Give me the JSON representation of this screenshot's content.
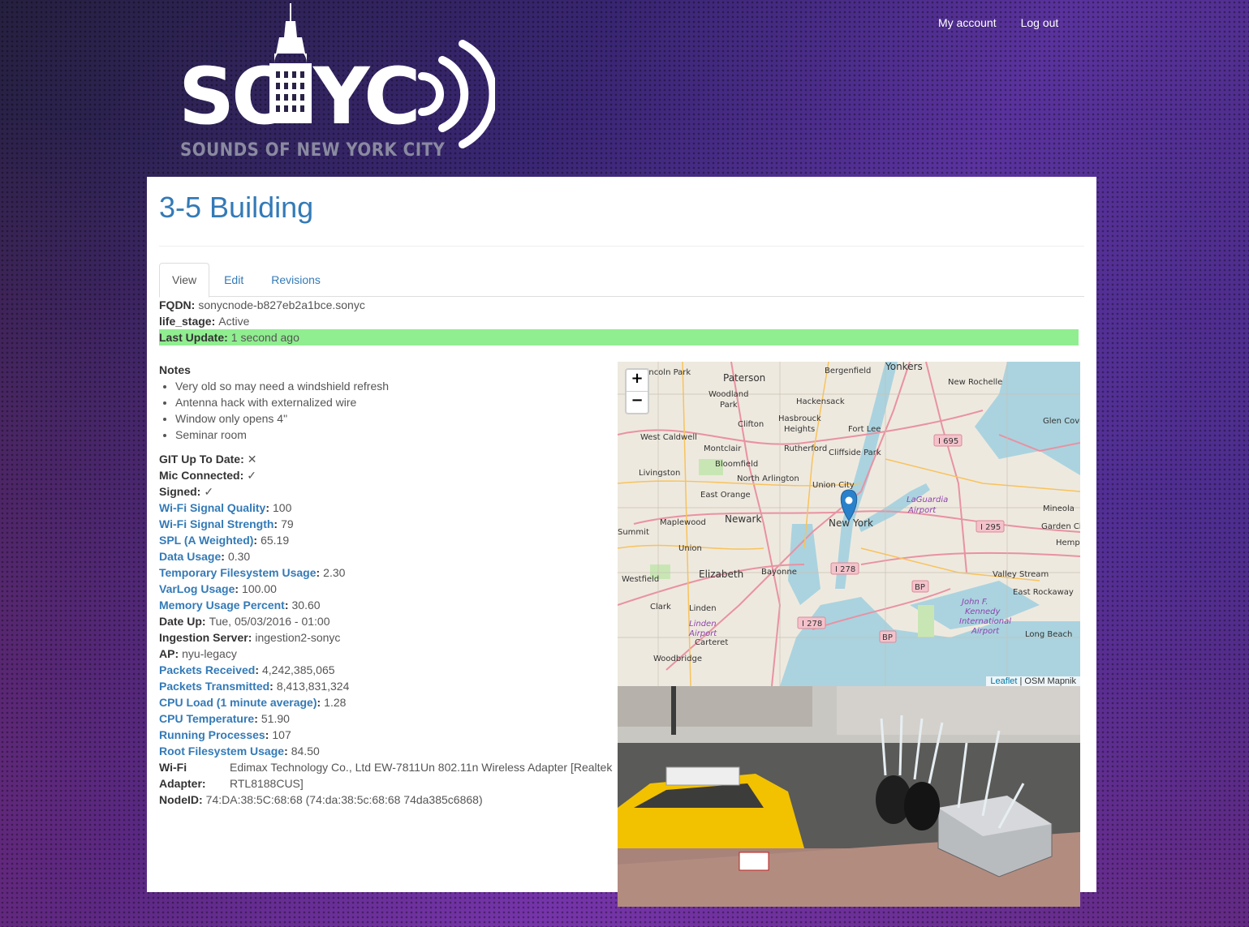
{
  "header": {
    "logo_text": "SONYC",
    "logo_subtitle": "SOUNDS OF NEW YORK CITY",
    "nav": {
      "my_account": "My account",
      "log_out": "Log out"
    }
  },
  "page": {
    "title": "3-5 Building",
    "tabs": [
      {
        "label": "View",
        "active": true
      },
      {
        "label": "Edit",
        "active": false
      },
      {
        "label": "Revisions",
        "active": false
      }
    ]
  },
  "summary": {
    "fqdn": {
      "label": "FQDN:",
      "value": "sonycnode-b827eb2a1bce.sonyc"
    },
    "life_stage": {
      "label": "life_stage:",
      "value": "Active"
    },
    "last_update": {
      "label": "Last Update:",
      "value": "1 second ago",
      "color": "#90ee90"
    }
  },
  "notes": {
    "label": "Notes",
    "items": [
      "Very old so may need a windshield refresh",
      "Antenna hack with externalized wire",
      "Window only opens 4\"",
      "Seminar room"
    ]
  },
  "fields": {
    "git": {
      "label": "GIT Up To Date:",
      "value": "✕"
    },
    "mic": {
      "label": "Mic Connected:",
      "value": "✓"
    },
    "signed": {
      "label": "Signed:",
      "value": "✓"
    },
    "wifi_quality": {
      "label": "Wi-Fi Signal Quality",
      "value": "100"
    },
    "wifi_strength": {
      "label": "Wi-Fi Signal Strength",
      "value": "79"
    },
    "spl": {
      "label": "SPL (A Weighted)",
      "value": "65.19"
    },
    "data_usage": {
      "label": "Data Usage",
      "value": "0.30"
    },
    "tmpfs": {
      "label": "Temporary Filesystem Usage",
      "value": "2.30"
    },
    "varlog": {
      "label": "VarLog Usage",
      "value": "100.00"
    },
    "memory": {
      "label": "Memory Usage Percent",
      "value": "30.60"
    },
    "date_up": {
      "label": "Date Up:",
      "value": "Tue, 05/03/2016 - 01:00"
    },
    "ingestion": {
      "label": "Ingestion Server:",
      "value": "ingestion2-sonyc"
    },
    "ap": {
      "label": "AP:",
      "value": "nyu-legacy"
    },
    "packets_rx": {
      "label": "Packets Received",
      "value": "4,242,385,065"
    },
    "packets_tx": {
      "label": "Packets Transmitted",
      "value": "8,413,831,324"
    },
    "cpu_load": {
      "label": "CPU Load (1 minute average)",
      "value": "1.28"
    },
    "cpu_temp": {
      "label": "CPU Temperature",
      "value": "51.90"
    },
    "processes": {
      "label": "Running Processes",
      "value": "107"
    },
    "root_fs": {
      "label": "Root Filesystem Usage",
      "value": "84.50"
    },
    "wifi_adapter": {
      "label": "Wi-Fi Adapter:",
      "value": "Edimax Technology Co., Ltd EW-7811Un 802.11n Wireless Adapter [Realtek RTL8188CUS]"
    },
    "node_id": {
      "label": "NodeID:",
      "value": "74:DA:38:5C:68:68 (74:da:38:5c:68:68 74da385c6868)"
    }
  },
  "map": {
    "zoom_in": "+",
    "zoom_out": "−",
    "attribution_link": "Leaflet",
    "attribution_rest": " | OSM Mapnik",
    "marker_label": "New York",
    "places": [
      "Paterson",
      "Bergenfield",
      "Yonkers",
      "New Rochelle",
      "Woodland Park",
      "Hackensack",
      "Clifton",
      "Hasbrouck Heights",
      "Fort Lee",
      "West Caldwell",
      "Montclair",
      "Rutherford",
      "Cliffside Park",
      "Glen Cove",
      "Bloomfield",
      "Livingston",
      "North Arlington",
      "Union City",
      "East Orange",
      "LaGuardia Airport",
      "Maplewood",
      "Newark",
      "Mineola",
      "Garden City",
      "Summit",
      "Union",
      "Hempstead",
      "Elizabeth",
      "Bayonne",
      "Valley Stream",
      "Westfield",
      "Linden",
      "East Rockaway",
      "Clark",
      "John F. Kennedy International Airport",
      "Linden Airport",
      "Carteret",
      "Long Beach",
      "Woodbridge",
      "Lincoln Park"
    ],
    "highways": [
      "I 695",
      "I 295",
      "I 278",
      "I 278",
      "BP",
      "BP"
    ]
  },
  "colors": {
    "link": "#337ab7",
    "highlight": "#90ee90",
    "background_dark": "#2a2247",
    "background_purple": "#5a35c0"
  }
}
